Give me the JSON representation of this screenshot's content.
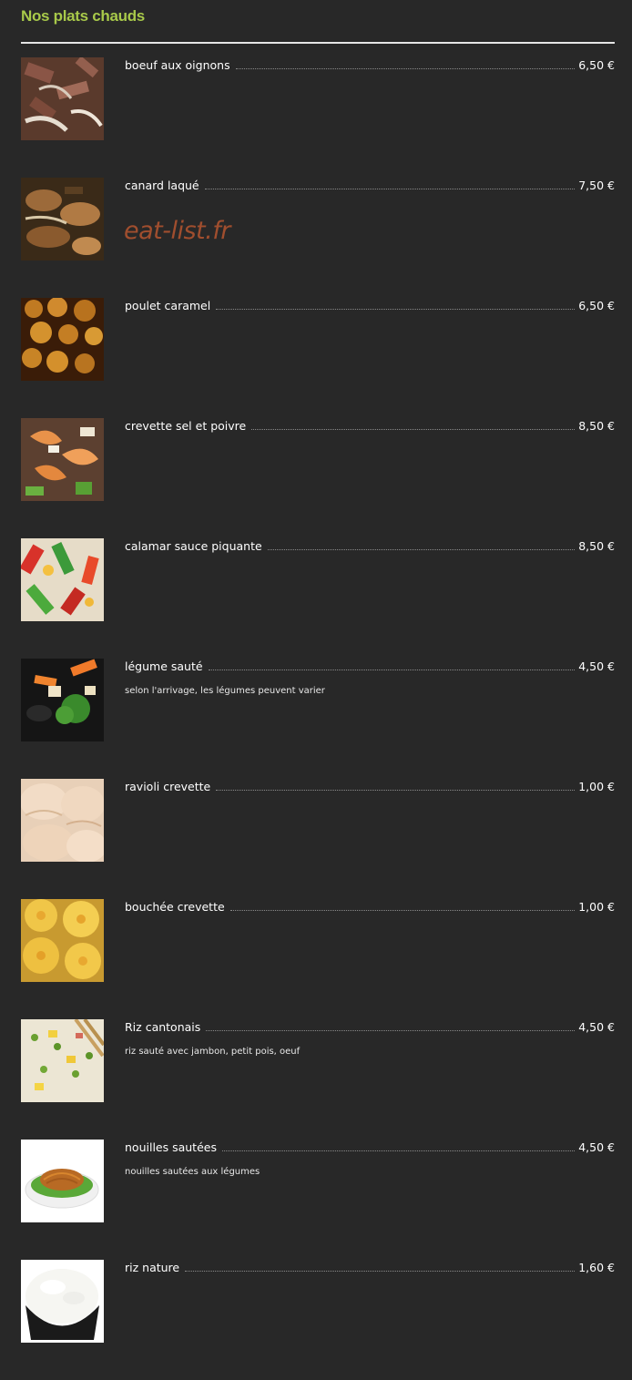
{
  "section": {
    "title": "Nos plats chauds"
  },
  "watermark": "eat-list.fr",
  "items": [
    {
      "name": "boeuf aux oignons",
      "price": "6,50 €",
      "description": "",
      "image": "beef-onion-photo"
    },
    {
      "name": "canard laqué",
      "price": "7,50 €",
      "description": "",
      "image": "lacquered-duck-photo"
    },
    {
      "name": "poulet caramel",
      "price": "6,50 €",
      "description": "",
      "image": "caramel-chicken-photo"
    },
    {
      "name": "crevette sel et poivre",
      "price": "8,50 €",
      "description": "",
      "image": "salt-pepper-shrimp-photo"
    },
    {
      "name": "calamar sauce piquante",
      "price": "8,50 €",
      "description": "",
      "image": "spicy-squid-photo"
    },
    {
      "name": "légume sauté",
      "price": "4,50 €",
      "description": "selon l'arrivage, les légumes peuvent varier",
      "image": "stir-fried-vegetables-photo"
    },
    {
      "name": "ravioli crevette",
      "price": "1,00 €",
      "description": "",
      "image": "shrimp-dumpling-photo"
    },
    {
      "name": "bouchée crevette",
      "price": "1,00 €",
      "description": "",
      "image": "shrimp-shumai-photo"
    },
    {
      "name": "Riz cantonais",
      "price": "4,50 €",
      "description": "riz sauté avec jambon, petit pois, oeuf",
      "image": "cantonese-rice-photo"
    },
    {
      "name": "nouilles sautées",
      "price": "4,50 €",
      "description": "nouilles sautées aux légumes",
      "image": "fried-noodles-photo"
    },
    {
      "name": "riz nature",
      "price": "1,60 €",
      "description": "",
      "image": "plain-rice-photo"
    }
  ],
  "colors": {
    "background": "#282828",
    "title": "#a8c94a",
    "watermark": "#a04e2e",
    "text": "#ffffff"
  }
}
